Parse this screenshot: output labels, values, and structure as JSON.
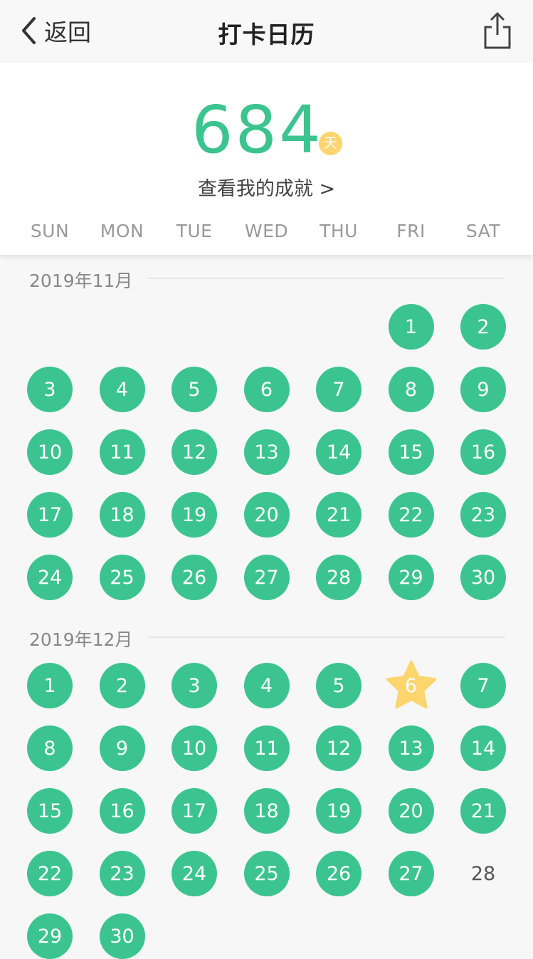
{
  "nav": {
    "back_label": "返回",
    "title": "打卡日历"
  },
  "summary": {
    "count": "684",
    "unit": "天",
    "achievements_link": "查看我的成就 >"
  },
  "weekdays": [
    "SUN",
    "MON",
    "TUE",
    "WED",
    "THU",
    "FRI",
    "SAT"
  ],
  "colors": {
    "accent": "#3cc490",
    "today_star": "#fcd56e"
  },
  "months": [
    {
      "title": "2019年11月",
      "first_weekday": 5,
      "days": 30,
      "today": null,
      "unchecked": []
    },
    {
      "title": "2019年12月",
      "first_weekday": 0,
      "days": 30,
      "today": 6,
      "unchecked": [
        28
      ]
    }
  ]
}
